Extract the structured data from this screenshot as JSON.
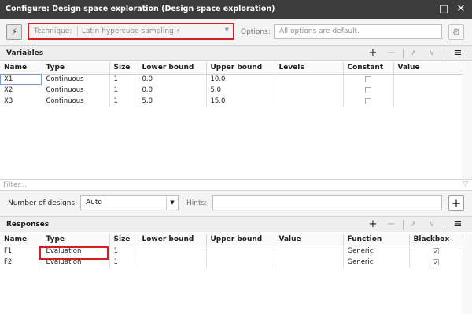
{
  "window": {
    "title": "Configure: Design space exploration (Design space exploration)",
    "restore_icon": "restore-window-icon",
    "close_icon": "close-icon"
  },
  "toolbar": {
    "run_icon": "lightning-icon",
    "technique_label": "Technique:",
    "technique_value": "Latin hypercube sampling",
    "options_label": "Options:",
    "options_value": "All options are default.",
    "settings_icon": "gear-icon"
  },
  "variables": {
    "title": "Variables",
    "columns": [
      "Name",
      "Type",
      "Size",
      "Lower bound",
      "Upper bound",
      "Levels",
      "Constant",
      "Value"
    ],
    "rows": [
      {
        "name": "X1",
        "type": "Continuous",
        "size": "1",
        "lower": "0.0",
        "upper": "10.0",
        "levels": "",
        "constant": false,
        "value": ""
      },
      {
        "name": "X2",
        "type": "Continuous",
        "size": "1",
        "lower": "0.0",
        "upper": "5.0",
        "levels": "",
        "constant": false,
        "value": ""
      },
      {
        "name": "X3",
        "type": "Continuous",
        "size": "1",
        "lower": "5.0",
        "upper": "15.0",
        "levels": "",
        "constant": false,
        "value": ""
      }
    ]
  },
  "filter": {
    "placeholder": "Filter..."
  },
  "designs": {
    "label": "Number of designs:",
    "value": "Auto",
    "hints_label": "Hints:",
    "hints_value": ""
  },
  "responses": {
    "title": "Responses",
    "columns": [
      "Name",
      "Type",
      "Size",
      "Lower bound",
      "Upper bound",
      "Value",
      "Function",
      "Blackbox"
    ],
    "rows": [
      {
        "name": "F1",
        "type": "Evaluation",
        "size": "1",
        "lower": "",
        "upper": "",
        "value": "",
        "function": "Generic",
        "blackbox": true
      },
      {
        "name": "F2",
        "type": "Evaluation",
        "size": "1",
        "lower": "",
        "upper": "",
        "value": "",
        "function": "Generic",
        "blackbox": true
      }
    ]
  },
  "colors": {
    "titlebar": "#3c3c3c",
    "highlight": "#d81e1e"
  }
}
